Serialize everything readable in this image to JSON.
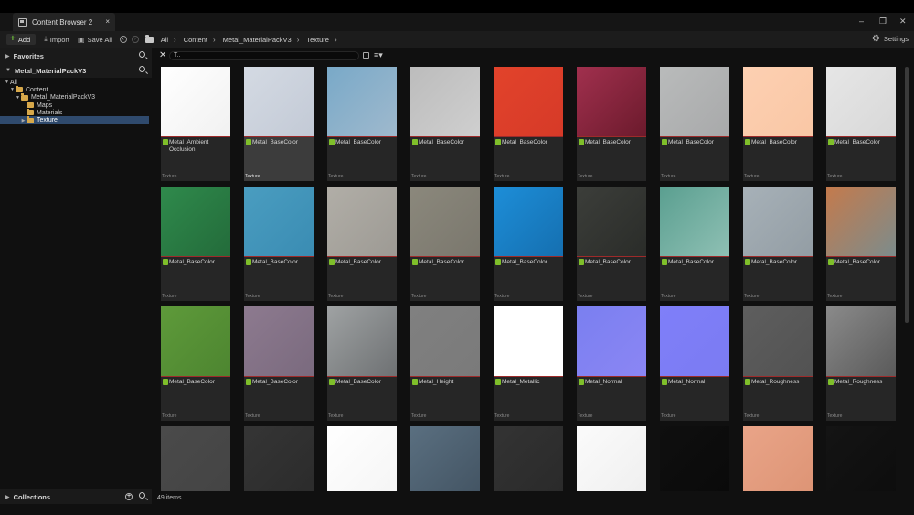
{
  "window": {
    "tab_title": "Content Browser 2",
    "tab_close": "×",
    "controls": {
      "minimize": "–",
      "restore": "❐",
      "close": "✕"
    }
  },
  "toolbar": {
    "add_label": "Add",
    "import_label": "Import",
    "save_all_label": "Save All",
    "breadcrumbs": [
      "All",
      "Content",
      "Metal_MaterialPackV3",
      "Texture"
    ],
    "settings_label": "Settings"
  },
  "sidebar": {
    "favorites_label": "Favorites",
    "project_label": "Metal_MaterialPackV3",
    "tree": [
      {
        "label": "All",
        "depth": 0,
        "expanded": true
      },
      {
        "label": "Content",
        "depth": 1,
        "expanded": true
      },
      {
        "label": "Metal_MaterialPackV3",
        "depth": 2,
        "expanded": true
      },
      {
        "label": "Maps",
        "depth": 3
      },
      {
        "label": "Materials",
        "depth": 3
      },
      {
        "label": "Texture",
        "depth": 3,
        "selected": true
      }
    ],
    "collections_label": "Collections"
  },
  "search": {
    "value": "T.."
  },
  "assets": [
    {
      "name": "Metal_Ambient Occlusion",
      "type": "Texture",
      "colors": [
        "#ffffff",
        "#f1f1f1"
      ]
    },
    {
      "name": "Metal_BaseColor",
      "type": "Texture",
      "colors": [
        "#d4dae3",
        "#c3cad6"
      ],
      "selected": true
    },
    {
      "name": "Metal_BaseColor",
      "type": "Texture",
      "colors": [
        "#79a9c8",
        "#9fb9cd"
      ]
    },
    {
      "name": "Metal_BaseColor",
      "type": "Texture",
      "colors": [
        "#bcbcbc",
        "#cfcfcf"
      ]
    },
    {
      "name": "Metal_BaseColor",
      "type": "Texture",
      "colors": [
        "#e2432b",
        "#d63a28"
      ]
    },
    {
      "name": "Metal_BaseColor",
      "type": "Texture",
      "colors": [
        "#a1304e",
        "#6b1a2c"
      ]
    },
    {
      "name": "Metal_BaseColor",
      "type": "Texture",
      "colors": [
        "#b9bbbb",
        "#a8a9aa"
      ]
    },
    {
      "name": "Metal_BaseColor",
      "type": "Texture",
      "colors": [
        "#fdd0b2",
        "#f9c7a5"
      ]
    },
    {
      "name": "Metal_BaseColor",
      "type": "Texture",
      "colors": [
        "#e6e6e6",
        "#d8d8d8"
      ]
    },
    {
      "name": "Metal_BaseColor",
      "type": "Texture",
      "colors": [
        "#2f8a4c",
        "#236b3a"
      ]
    },
    {
      "name": "Metal_BaseColor",
      "type": "Texture",
      "colors": [
        "#4a9dc0",
        "#3a8cb3"
      ]
    },
    {
      "name": "Metal_BaseColor",
      "type": "Texture",
      "colors": [
        "#b1aea7",
        "#9d9a94"
      ]
    },
    {
      "name": "Metal_BaseColor",
      "type": "Texture",
      "colors": [
        "#8b887c",
        "#7a776d"
      ]
    },
    {
      "name": "Metal_BaseColor",
      "type": "Texture",
      "colors": [
        "#1d8ed8",
        "#156fb0"
      ]
    },
    {
      "name": "Metal_BaseColor",
      "type": "Texture",
      "colors": [
        "#3c3e3a",
        "#2a2c29"
      ]
    },
    {
      "name": "Metal_BaseColor",
      "type": "Texture",
      "colors": [
        "#5a9f90",
        "#8fc0b4"
      ]
    },
    {
      "name": "Metal_BaseColor",
      "type": "Texture",
      "colors": [
        "#a7b1b8",
        "#939da4"
      ]
    },
    {
      "name": "Metal_BaseColor",
      "type": "Texture",
      "colors": [
        "#c47a4c",
        "#7c8c8c"
      ]
    },
    {
      "name": "Metal_BaseColor",
      "type": "Texture",
      "colors": [
        "#5e9a3a",
        "#4d8530"
      ]
    },
    {
      "name": "Metal_BaseColor",
      "type": "Texture",
      "colors": [
        "#8d7a8f",
        "#7a6a7e"
      ]
    },
    {
      "name": "Metal_BaseColor",
      "type": "Texture",
      "colors": [
        "#9fa2a3",
        "#6e7173"
      ]
    },
    {
      "name": "Metal_Height",
      "type": "Texture",
      "colors": [
        "#808080",
        "#7a7a7a"
      ]
    },
    {
      "name": "Metal_Metallic",
      "type": "Texture",
      "colors": [
        "#ffffff",
        "#ffffff"
      ]
    },
    {
      "name": "Metal_Normal",
      "type": "Texture",
      "colors": [
        "#7a7ff0",
        "#8b86f4"
      ]
    },
    {
      "name": "Metal_Normal",
      "type": "Texture",
      "colors": [
        "#7f7ff9",
        "#7b7bf2"
      ]
    },
    {
      "name": "Metal_Roughness",
      "type": "Texture",
      "colors": [
        "#5e5e5e",
        "#525252"
      ]
    },
    {
      "name": "Metal_Roughness",
      "type": "Texture",
      "colors": [
        "#8a8a8a",
        "#5a5a5a"
      ]
    },
    {
      "name": "",
      "type": "",
      "colors": [
        "#4a4a4a",
        "#444444"
      ]
    },
    {
      "name": "",
      "type": "",
      "colors": [
        "#353535",
        "#2b2b2b"
      ]
    },
    {
      "name": "",
      "type": "",
      "colors": [
        "#ffffff",
        "#f5f5f5"
      ]
    },
    {
      "name": "",
      "type": "",
      "colors": [
        "#5a6f80",
        "#435463"
      ]
    },
    {
      "name": "",
      "type": "",
      "colors": [
        "#333333",
        "#2a2a2a"
      ]
    },
    {
      "name": "",
      "type": "",
      "colors": [
        "#fbfbfb",
        "#efefef"
      ]
    },
    {
      "name": "",
      "type": "",
      "colors": [
        "#0f0f0f",
        "#0a0a0a"
      ]
    },
    {
      "name": "",
      "type": "",
      "colors": [
        "#e9a488",
        "#dd9475"
      ]
    },
    {
      "name": "",
      "type": "",
      "colors": [
        "#141414",
        "#0d0d0d"
      ]
    }
  ],
  "status": {
    "item_count": "49 items"
  }
}
